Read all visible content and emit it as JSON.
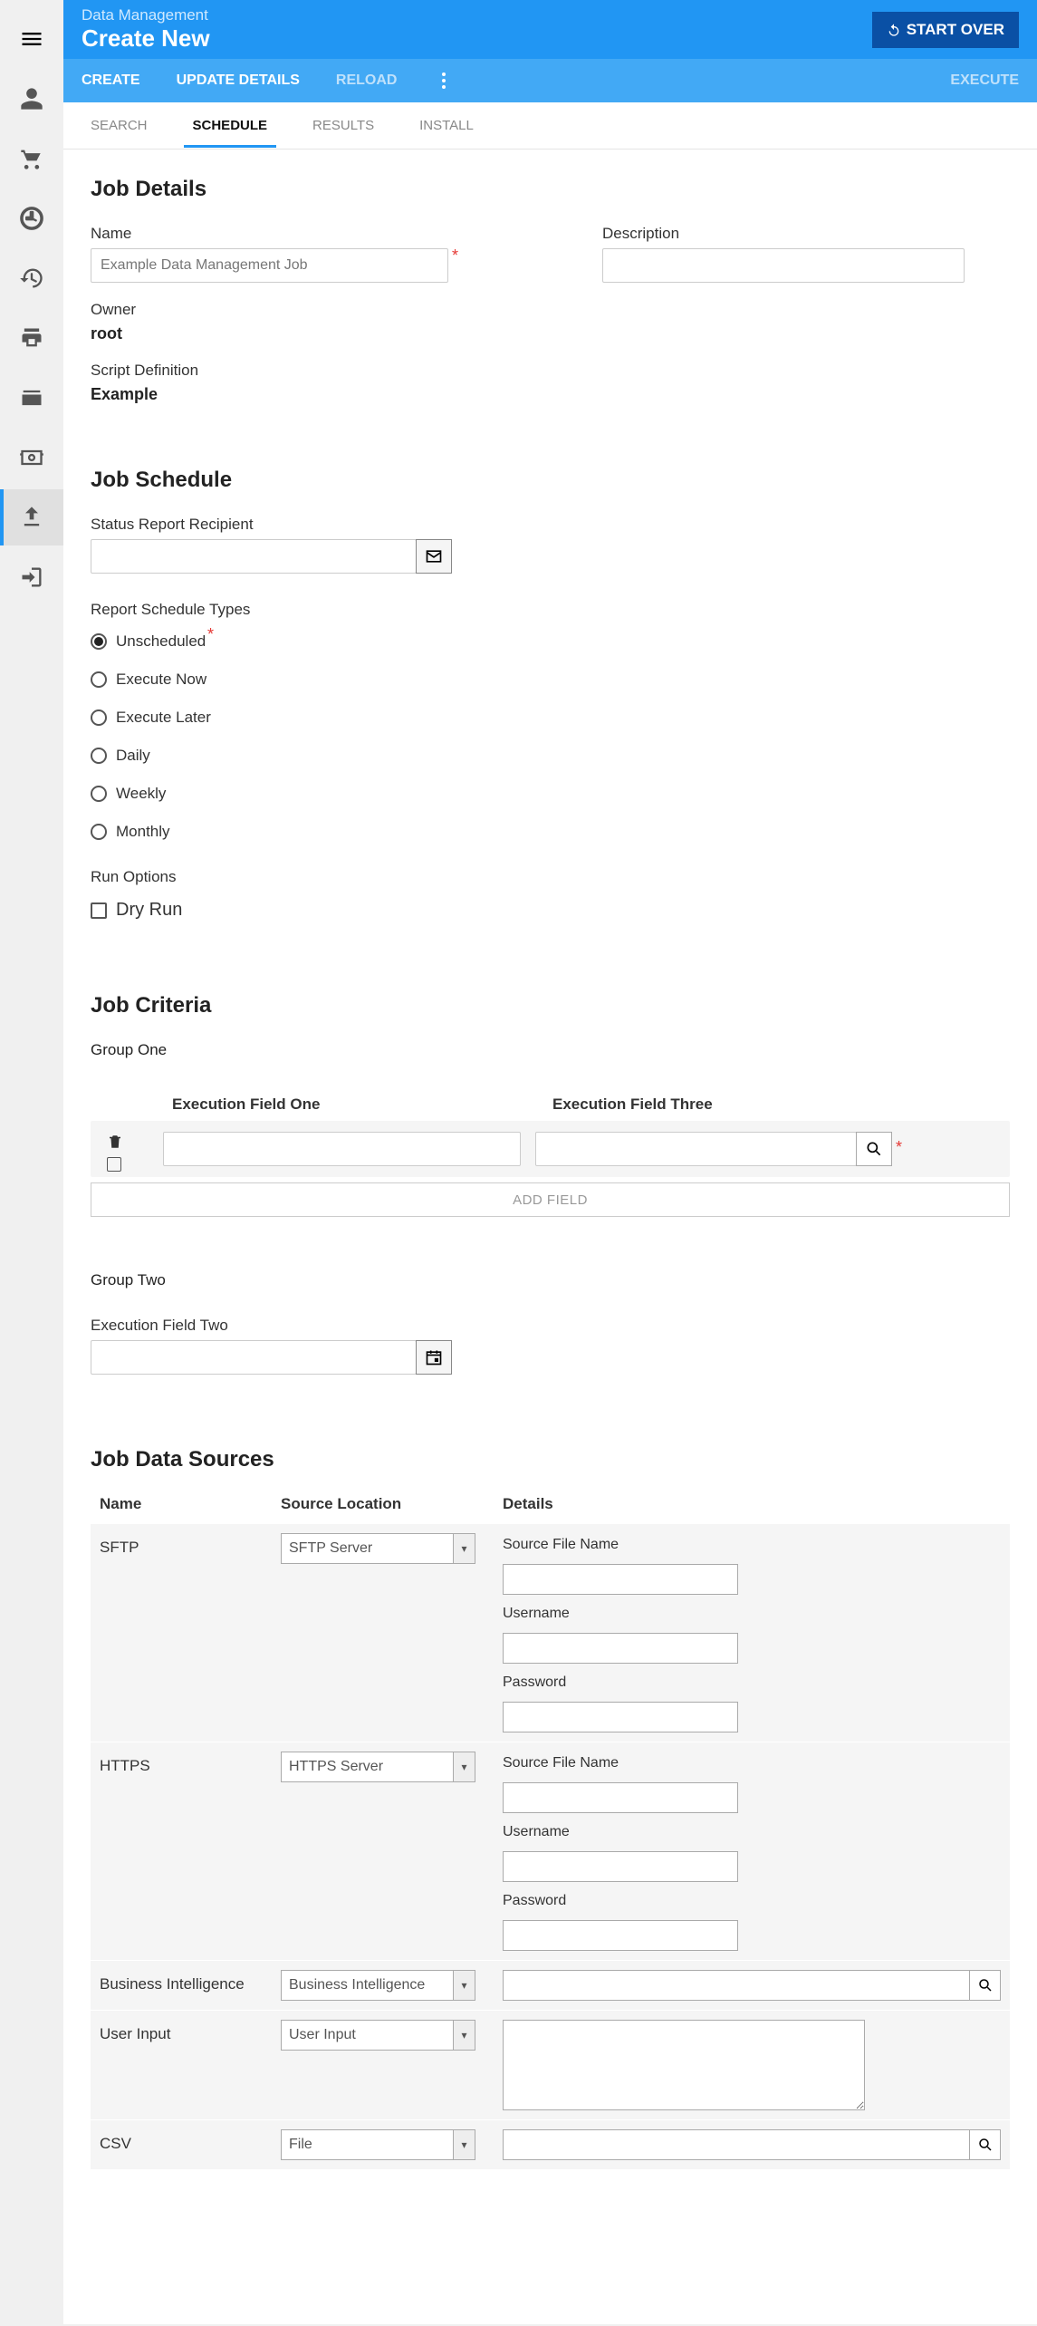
{
  "sidebar": {
    "items": [
      "menu",
      "user",
      "cart",
      "clock",
      "history",
      "print",
      "scan",
      "payment",
      "upload",
      "login"
    ]
  },
  "header": {
    "breadcrumb": "Data Management",
    "title": "Create New",
    "startover": "START OVER"
  },
  "secbar": {
    "create": "CREATE",
    "update": "UPDATE DETAILS",
    "reload": "RELOAD",
    "execute": "EXECUTE"
  },
  "tabs": {
    "search": "SEARCH",
    "schedule": "SCHEDULE",
    "results": "RESULTS",
    "install": "INSTALL"
  },
  "jobDetails": {
    "heading": "Job Details",
    "nameLabel": "Name",
    "nameValue": "Example Data Management Job",
    "descLabel": "Description",
    "descValue": "",
    "ownerLabel": "Owner",
    "ownerValue": "root",
    "scriptLabel": "Script Definition",
    "scriptValue": "Example"
  },
  "jobSchedule": {
    "heading": "Job Schedule",
    "recipientLabel": "Status Report Recipient",
    "recipientValue": "",
    "typesLabel": "Report Schedule Types",
    "types": [
      "Unscheduled",
      "Execute Now",
      "Execute Later",
      "Daily",
      "Weekly",
      "Monthly"
    ],
    "runOptionsLabel": "Run Options",
    "dryRun": "Dry Run"
  },
  "jobCriteria": {
    "heading": "Job Criteria",
    "group1": {
      "title": "Group One",
      "field1": "Execution Field One",
      "field3": "Execution Field Three",
      "addField": "ADD FIELD"
    },
    "group2": {
      "title": "Group Two",
      "field2": "Execution Field Two"
    }
  },
  "dataSources": {
    "heading": "Job Data Sources",
    "headers": {
      "name": "Name",
      "loc": "Source Location",
      "details": "Details"
    },
    "rows": [
      {
        "name": "SFTP",
        "select": "SFTP Server",
        "type": "server",
        "sourceFileLabel": "Source File Name",
        "userLabel": "Username",
        "passLabel": "Password"
      },
      {
        "name": "HTTPS",
        "select": "HTTPS Server",
        "type": "server",
        "sourceFileLabel": "Source File Name",
        "userLabel": "Username",
        "passLabel": "Password"
      },
      {
        "name": "Business Intelligence",
        "select": "Business Intelligence",
        "type": "search"
      },
      {
        "name": "User Input",
        "select": "User Input",
        "type": "textarea"
      },
      {
        "name": "CSV",
        "select": "File",
        "type": "search"
      }
    ]
  }
}
